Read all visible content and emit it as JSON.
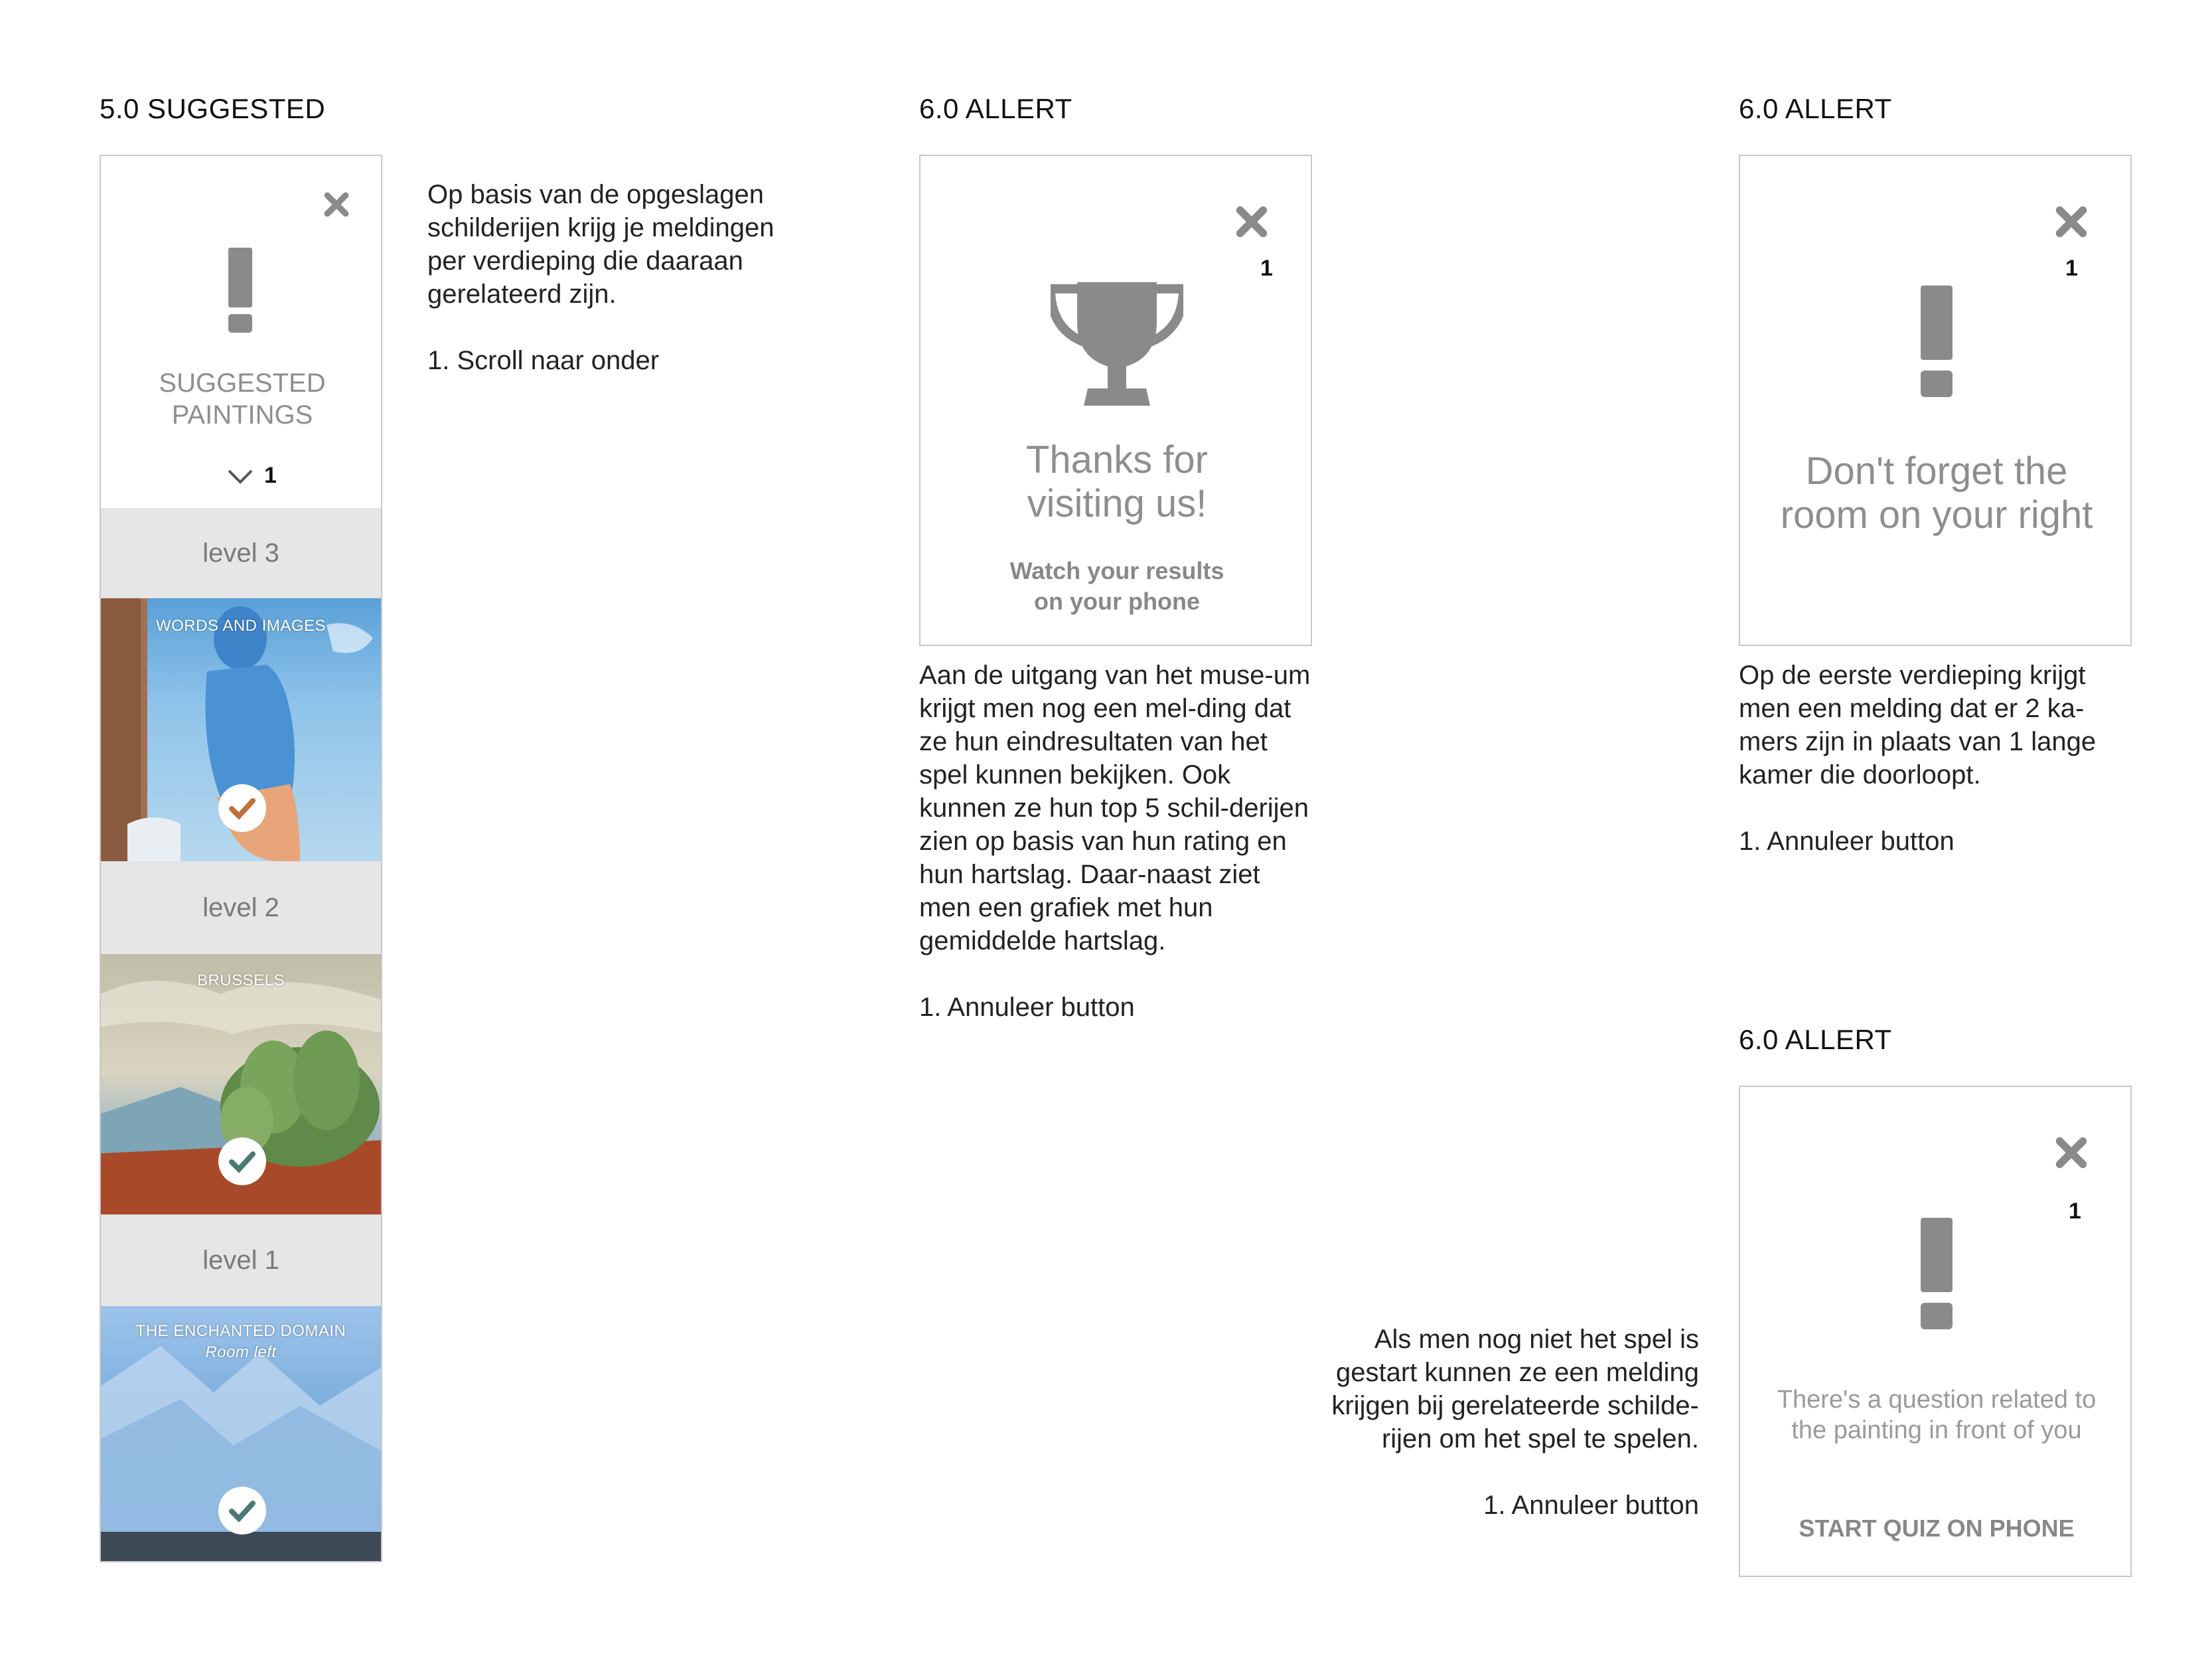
{
  "suggested": {
    "title": "5.0 SUGGESTED",
    "heading_line1": "SUGGESTED",
    "heading_line2": "PAINTINGS",
    "counter": "1",
    "levels": [
      {
        "label": "level 3",
        "painting_title": "WORDS AND IMAGES",
        "painting_sub": ""
      },
      {
        "label": "level 2",
        "painting_title": "BRUSSELS",
        "painting_sub": ""
      },
      {
        "label": "level 1",
        "painting_title": "THE ENCHANTED DOMAIN",
        "painting_sub": "Room left"
      }
    ],
    "desc_p1": "Op basis van de opgeslagen schilderijen krijg je meldingen per verdieping die daaraan gerelateerd zijn.",
    "desc_p2": "1. Scroll naar onder"
  },
  "alert_trophy": {
    "title": "6.0 ALLERT",
    "counter": "1",
    "message_line1": "Thanks for",
    "message_line2": "visiting us!",
    "sub_line1": "Watch your results",
    "sub_line2": "on your phone",
    "desc_p1": "Aan de uitgang van het muse-um krijgt men nog een mel-ding dat ze hun eindresultaten van het spel kunnen bekijken. Ook kunnen ze hun top 5 schil-derijen zien op basis van hun rating en hun hartslag. Daar-naast ziet men een grafiek met hun gemiddelde hartslag.",
    "desc_p2": "1. Annuleer button"
  },
  "alert_room": {
    "title": "6.0 ALLERT",
    "counter": "1",
    "message_line1": "Don't forget the",
    "message_line2": "room on your right",
    "desc_p1": "Op de eerste verdieping krijgt men een melding dat er 2 ka-mers zijn in plaats van 1 lange kamer die doorloopt.",
    "desc_p2": "1. Annuleer button"
  },
  "alert_quiz": {
    "title": "6.0 ALLERT",
    "counter": "1",
    "message_line1": "There's a question related to",
    "message_line2": "the painting in front of you",
    "button_label": "START QUIZ ON PHONE",
    "desc_p1": "Als men nog niet het spel is gestart kunnen ze een melding krijgen bij gerelateerde schilde-rijen om het spel te spelen.",
    "desc_p2": "1. Annuleer button"
  },
  "colors": {
    "icon_gray": "#8a8a8a",
    "frame_border": "#c8c8c8",
    "level_bar": "#e6e6e6",
    "check_orange": "#c0703a",
    "check_teal": "#4a7a72"
  }
}
